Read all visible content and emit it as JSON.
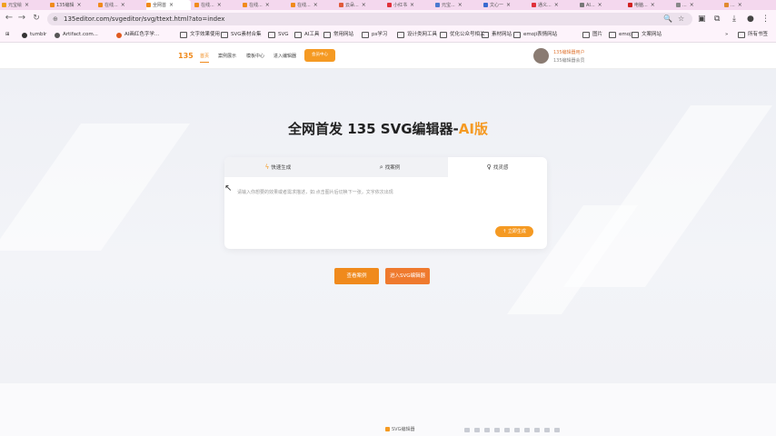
{
  "browser": {
    "tabs": [
      {
        "label": "元宝绘",
        "color": "#f0a020"
      },
      {
        "label": "135编辑",
        "color": "#f08a1c"
      },
      {
        "label": "在线...",
        "color": "#f08a1c"
      },
      {
        "label": "全网首",
        "color": "#f08a1c",
        "active": true
      },
      {
        "label": "在线...",
        "color": "#f08a1c"
      },
      {
        "label": "在线...",
        "color": "#f08a1c"
      },
      {
        "label": "在线...",
        "color": "#f08a1c"
      },
      {
        "label": "云朵...",
        "color": "#e05a3a"
      },
      {
        "label": "小红书",
        "color": "#e0303a"
      },
      {
        "label": "元宝...",
        "color": "#4a7ad0"
      },
      {
        "label": "文心一",
        "color": "#3a6ad0"
      },
      {
        "label": "通义...",
        "color": "#e0303a"
      },
      {
        "label": "AI...",
        "color": "#777"
      },
      {
        "label": "电脑...",
        "color": "#d02020"
      },
      {
        "label": "...",
        "color": "#888"
      },
      {
        "label": "...",
        "color": "#e08a30"
      }
    ],
    "url": "135editor.com/svgeditor/svg/ttext.html?ato=index",
    "info_icon": "site-info-icon",
    "bookmarks": [
      {
        "label": "tumblr",
        "kind": "dot",
        "color": "#333"
      },
      {
        "label": "Artifact.com...",
        "kind": "dot",
        "color": "#555"
      },
      {
        "label": "AI画红色字学...",
        "kind": "dot",
        "color": "#e05a20"
      },
      {
        "label": "文字效果使用",
        "kind": "folder"
      },
      {
        "label": "SVG素材合集",
        "kind": "folder"
      },
      {
        "label": "SVG",
        "kind": "folder"
      },
      {
        "label": "AI工具",
        "kind": "folder"
      },
      {
        "label": "常用网站",
        "kind": "folder"
      },
      {
        "label": "ps学习",
        "kind": "folder"
      },
      {
        "label": "设计类网工具",
        "kind": "folder"
      },
      {
        "label": "优化公众号相关",
        "kind": "folder"
      },
      {
        "label": "素材网站",
        "kind": "folder"
      },
      {
        "label": "emoji表情网站",
        "kind": "folder"
      },
      {
        "label": "图片",
        "kind": "folder"
      },
      {
        "label": "emoji",
        "kind": "folder"
      },
      {
        "label": "文案网站",
        "kind": "folder"
      }
    ],
    "all_bookmarks": "所有书签"
  },
  "site": {
    "logo": "135",
    "nav": [
      {
        "label": "首页",
        "active": true
      },
      {
        "label": "案例展示"
      },
      {
        "label": "模板中心"
      },
      {
        "label": "进入编辑器"
      }
    ],
    "member_button": "会员中心",
    "user_name": "135编辑器用户",
    "user_sub": "135编辑器会员"
  },
  "hero": {
    "title_main": "全网首发 135 SVG编辑器-",
    "title_ai": "AI版",
    "tabs": [
      {
        "label": "快速生成",
        "icon": "lightning-icon"
      },
      {
        "label": "找案例",
        "icon": "search-icon"
      },
      {
        "label": "找灵感",
        "icon": "lightbulb-icon"
      }
    ],
    "placeholder": "请输入你想要的效果或者需求描述，如:点击图片后切换下一张，文字依次出现",
    "generate_button": "立即生成",
    "cta_cases": "查看案例",
    "cta_editor": "进入SVG编辑器"
  },
  "taskbar": {
    "label": "SVG编辑器"
  }
}
